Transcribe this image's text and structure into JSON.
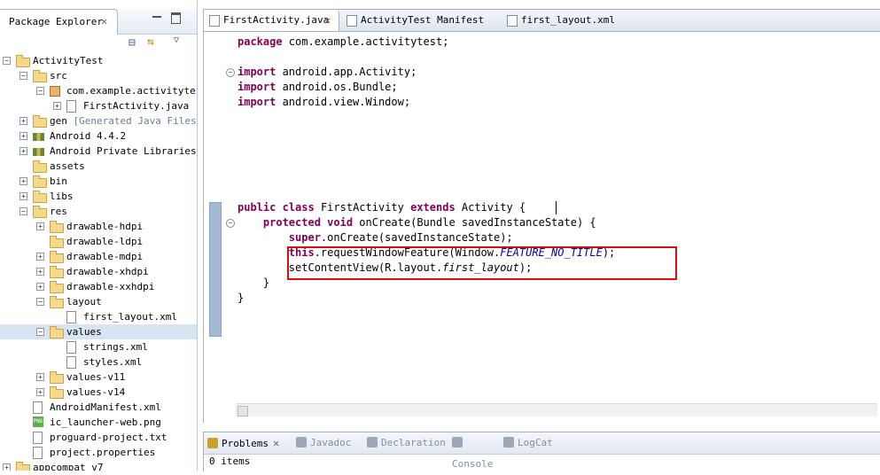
{
  "package_explorer": {
    "tab_label": "Package Explorer",
    "tree": [
      {
        "label": "ActivityTest",
        "indent": 0,
        "expander": "−",
        "icon": "project"
      },
      {
        "label": "src",
        "indent": 1,
        "expander": "−",
        "icon": "folder"
      },
      {
        "label": "com.example.activitytes",
        "indent": 2,
        "expander": "−",
        "icon": "package"
      },
      {
        "label": "FirstActivity.java",
        "indent": 3,
        "expander": "+",
        "icon": "java-file"
      },
      {
        "label": "gen",
        "suffix": "[Generated Java Files]",
        "indent": 1,
        "expander": "+",
        "icon": "folder"
      },
      {
        "label": "Android 4.4.2",
        "indent": 1,
        "expander": "+",
        "icon": "library"
      },
      {
        "label": "Android Private Libraries",
        "indent": 1,
        "expander": "+",
        "icon": "library"
      },
      {
        "label": "assets",
        "indent": 1,
        "expander": "",
        "icon": "folder"
      },
      {
        "label": "bin",
        "indent": 1,
        "expander": "+",
        "icon": "folder"
      },
      {
        "label": "libs",
        "indent": 1,
        "expander": "+",
        "icon": "folder"
      },
      {
        "label": "res",
        "indent": 1,
        "expander": "−",
        "icon": "folder"
      },
      {
        "label": "drawable-hdpi",
        "indent": 2,
        "expander": "+",
        "icon": "folder"
      },
      {
        "label": "drawable-ldpi",
        "indent": 2,
        "expander": "",
        "icon": "folder"
      },
      {
        "label": "drawable-mdpi",
        "indent": 2,
        "expander": "+",
        "icon": "folder"
      },
      {
        "label": "drawable-xhdpi",
        "indent": 2,
        "expander": "+",
        "icon": "folder"
      },
      {
        "label": "drawable-xxhdpi",
        "indent": 2,
        "expander": "+",
        "icon": "folder"
      },
      {
        "label": "layout",
        "indent": 2,
        "expander": "−",
        "icon": "folder"
      },
      {
        "label": "first_layout.xml",
        "indent": 3,
        "expander": "",
        "icon": "xml-file"
      },
      {
        "label": "values",
        "indent": 2,
        "expander": "−",
        "icon": "folder",
        "selected": true
      },
      {
        "label": "strings.xml",
        "indent": 3,
        "expander": "",
        "icon": "xml-file"
      },
      {
        "label": "styles.xml",
        "indent": 3,
        "expander": "",
        "icon": "xml-file"
      },
      {
        "label": "values-v11",
        "indent": 2,
        "expander": "+",
        "icon": "folder"
      },
      {
        "label": "values-v14",
        "indent": 2,
        "expander": "+",
        "icon": "folder"
      },
      {
        "label": "AndroidManifest.xml",
        "indent": 1,
        "expander": "",
        "icon": "xml-file"
      },
      {
        "label": "ic_launcher-web.png",
        "indent": 1,
        "expander": "",
        "icon": "png-file"
      },
      {
        "label": "proguard-project.txt",
        "indent": 1,
        "expander": "",
        "icon": "text-file"
      },
      {
        "label": "project.properties",
        "indent": 1,
        "expander": "",
        "icon": "text-file"
      },
      {
        "label": "appcompat_v7",
        "indent": 0,
        "expander": "+",
        "icon": "project"
      }
    ]
  },
  "editor": {
    "tabs": [
      {
        "label": "FirstActivity.java",
        "active": true
      },
      {
        "label": "ActivityTest Manifest",
        "active": false
      },
      {
        "label": "first_layout.xml",
        "active": false
      }
    ],
    "code": [
      {
        "row": 0,
        "parts": [
          [
            "kw",
            "package"
          ],
          [
            "",
            " com.example.activitytest;"
          ]
        ]
      },
      {
        "row": 2,
        "parts": [
          [
            "kw",
            "import"
          ],
          [
            "",
            " android.app.Activity;"
          ]
        ],
        "fold": "−"
      },
      {
        "row": 3,
        "parts": [
          [
            "kw",
            "import"
          ],
          [
            "",
            " android.os.Bundle;"
          ]
        ]
      },
      {
        "row": 4,
        "parts": [
          [
            "kw",
            "import"
          ],
          [
            "",
            " android.view.Window;"
          ]
        ]
      },
      {
        "row": 11,
        "parts": [
          [
            "kw",
            "public"
          ],
          [
            "",
            " "
          ],
          [
            "kw",
            "class"
          ],
          [
            "",
            " FirstActivity "
          ],
          [
            "kw",
            "extends"
          ],
          [
            "",
            " Activity {"
          ]
        ]
      },
      {
        "row": 12,
        "parts": [
          [
            "",
            "    "
          ],
          [
            "kw",
            "protected"
          ],
          [
            "",
            " "
          ],
          [
            "kw",
            "void"
          ],
          [
            "",
            " onCreate(Bundle savedInstanceState) {"
          ]
        ],
        "fold": "−"
      },
      {
        "row": 13,
        "parts": [
          [
            "",
            "        "
          ],
          [
            "kw",
            "super"
          ],
          [
            "",
            ".onCreate(savedInstanceState);"
          ]
        ]
      },
      {
        "row": 14,
        "parts": [
          [
            "",
            "        "
          ],
          [
            "kw",
            "this"
          ],
          [
            "",
            ".requestWindowFeature(Window."
          ],
          [
            "fld",
            "FEATURE_NO_TITLE"
          ],
          [
            "",
            ");"
          ]
        ]
      },
      {
        "row": 15,
        "parts": [
          [
            "",
            "        setContentView(R.layout."
          ],
          [
            "ital",
            "first_layout"
          ],
          [
            "",
            ");"
          ]
        ]
      },
      {
        "row": 16,
        "parts": [
          [
            "",
            "    }"
          ]
        ]
      },
      {
        "row": 17,
        "parts": [
          [
            "",
            "}"
          ]
        ]
      }
    ]
  },
  "bottom_panel": {
    "tabs": [
      {
        "label": "Problems",
        "active": true,
        "icon_color": "#c9a227"
      },
      {
        "label": "Javadoc",
        "active": false,
        "icon_color": "#9aa8b8"
      },
      {
        "label": "Declaration",
        "active": false,
        "icon_color": "#9aa8b8"
      },
      {
        "label": "Console",
        "active": false,
        "icon_color": "#9aa8b8"
      },
      {
        "label": "LogCat",
        "active": false,
        "icon_color": "#9aa8b8"
      }
    ],
    "status": "0 items"
  },
  "colors": {
    "keyword": "#7f0055",
    "static_field": "#0000c0",
    "highlight_box": "#d01010"
  }
}
